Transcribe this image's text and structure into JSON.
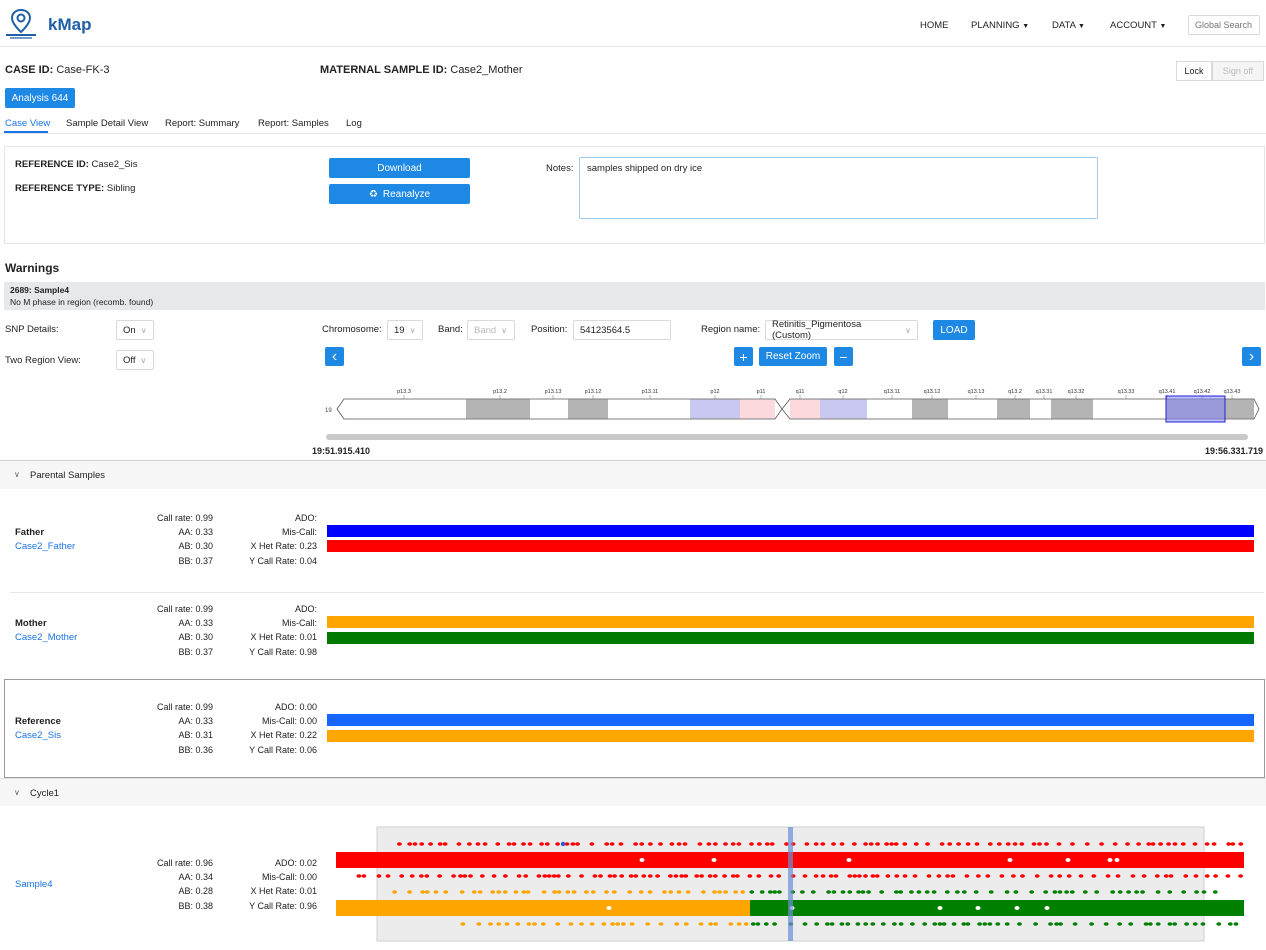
{
  "app": {
    "name": "kMap"
  },
  "nav": {
    "home": "HOME",
    "planning": "PLANNING",
    "data": "DATA",
    "account": "ACCOUNT",
    "caret": "▼",
    "search_placeholder": "Global Search"
  },
  "case": {
    "case_id_label": "CASE ID:",
    "case_id": "Case-FK-3",
    "maternal_label": "MATERNAL SAMPLE ID:",
    "maternal_id": "Case2_Mother",
    "lock": "Lock",
    "signoff": "Sign off",
    "analysis_button": "Analysis 644"
  },
  "tabs": [
    "Case View",
    "Sample Detail View",
    "Report: Summary",
    "Report: Samples",
    "Log"
  ],
  "reference": {
    "id_label": "REFERENCE ID:",
    "id": "Case2_Sis",
    "type_label": "REFERENCE TYPE:",
    "type": "Sibling",
    "download": "Download",
    "reanalyze": "Reanalyze",
    "reanalyze_icon": "♻",
    "notes_label": "Notes:",
    "notes": "samples shipped on dry ice"
  },
  "warnings": {
    "title": "Warnings",
    "item_title": "2689: Sample4",
    "item_text": "No M phase in region (recomb. found)"
  },
  "controls": {
    "snp_label": "SNP Details:",
    "snp_value": "On",
    "two_region_label": "Two Region View:",
    "two_region_value": "Off",
    "chromosome_label": "Chromosome:",
    "chromosome_value": "19",
    "band_label": "Band:",
    "band_placeholder": "Band",
    "position_label": "Position:",
    "position_value": "54123564.5",
    "region_label": "Region name:",
    "region_value": "Retinitis_Pigmentosa (Custom)",
    "load": "LOAD",
    "reset_zoom": "Reset Zoom",
    "plus": "+",
    "minus": "−",
    "prev": "‹",
    "next": "›",
    "chev": "∨"
  },
  "ideogram": {
    "chrom_label": "19",
    "bands": [
      "p13.3",
      "p13.2",
      "p13.13",
      "p13.12",
      "p13.11",
      "p12",
      "p11",
      "q11",
      "q12",
      "q13.11",
      "q13.12",
      "q13.13",
      "q13.2",
      "q13.31",
      "q13.32",
      "q13.33",
      "q13.41",
      "q13.42",
      "q13.43"
    ],
    "range_start": "19:51.915.410",
    "range_end": "19:56.331.719"
  },
  "parental": {
    "section_title": "Parental Samples",
    "samples": [
      {
        "role": "Father",
        "id": "Case2_Father",
        "stats_left": [
          "Call rate: 0.99",
          "AA: 0.33",
          "AB: 0.30",
          "BB: 0.37"
        ],
        "stats_right": [
          "ADO:",
          "Mis-Call:",
          "X Het Rate: 0.23",
          "Y Call Rate: 0.04"
        ],
        "colors": [
          "#0000ff",
          "#ff0000"
        ]
      },
      {
        "role": "Mother",
        "id": "Case2_Mother",
        "stats_left": [
          "Call rate: 0.99",
          "AA: 0.33",
          "AB: 0.30",
          "BB: 0.37"
        ],
        "stats_right": [
          "ADO:",
          "Mis-Call:",
          "X Het Rate: 0.01",
          "Y Call Rate: 0.98"
        ],
        "colors": [
          "#ffa500",
          "#007a00"
        ]
      },
      {
        "role": "Reference",
        "id": "Case2_Sis",
        "stats_left": [
          "Call rate: 0.99",
          "AA: 0.33",
          "AB: 0.31",
          "BB: 0.36"
        ],
        "stats_right": [
          "ADO: 0.00",
          "Mis-Call: 0.00",
          "X Het Rate: 0.22",
          "Y Call Rate: 0.06"
        ],
        "colors": [
          "#1565ff",
          "#ffa500"
        ]
      }
    ]
  },
  "cycle": {
    "section_title": "Cycle1",
    "sample": {
      "id": "Sample4",
      "stats_left": [
        "Call rate: 0.96",
        "AA: 0.34",
        "AB: 0.28",
        "BB: 0.38"
      ],
      "stats_right": [
        "ADO: 0.02",
        "Mis-Call: 0.00",
        "X Het Rate: 0.01",
        "Y Call Rate: 0.96"
      ]
    },
    "colors": {
      "paternal": "#ff0000",
      "maternal_a": "#ffa500",
      "maternal_b": "#008000",
      "marker": "#1e5bd6"
    }
  }
}
